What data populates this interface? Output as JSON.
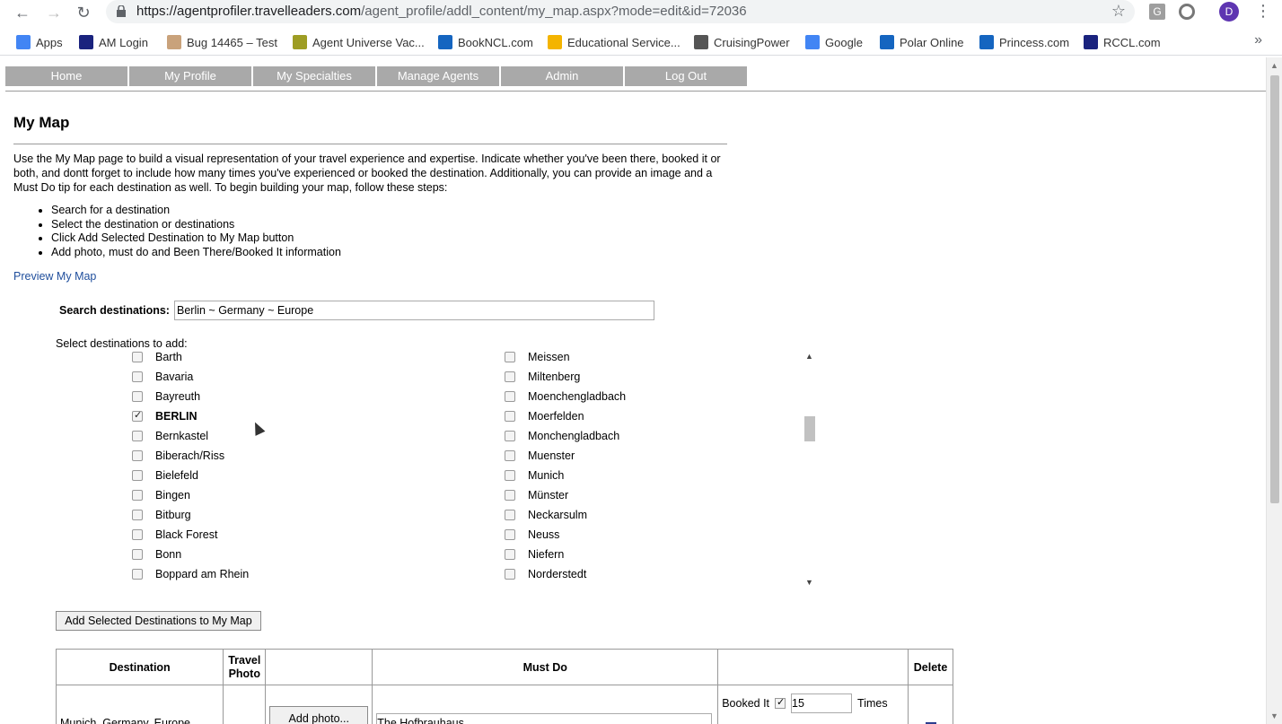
{
  "browser": {
    "url_domain": "https://agentprofiler.travelleaders.com",
    "url_path": "/agent_profile/addl_content/my_map.aspx?mode=edit&id=72036",
    "profile_initial": "D"
  },
  "bookmarks": [
    {
      "label": "Apps",
      "icon": "apps-grid-icon",
      "color": "#4285f4"
    },
    {
      "label": "AM Login",
      "icon": "am-login-icon",
      "color": "#1a237e"
    },
    {
      "label": "Bug 14465 – Test",
      "icon": "bug-icon",
      "color": "#c9a27b"
    },
    {
      "label": "Agent Universe Vac...",
      "icon": "agent-universe-icon",
      "color": "#9e9d24"
    },
    {
      "label": "BookNCL.com",
      "icon": "ncl-icon",
      "color": "#1565c0"
    },
    {
      "label": "Educational Service...",
      "icon": "drive-icon",
      "color": "#f4b400"
    },
    {
      "label": "CruisingPower",
      "icon": "cruisingpower-icon",
      "color": "#555555"
    },
    {
      "label": "Google",
      "icon": "google-icon",
      "color": "#4285f4"
    },
    {
      "label": "Polar Online",
      "icon": "polar-online-icon",
      "color": "#1565c0"
    },
    {
      "label": "Princess.com",
      "icon": "princess-icon",
      "color": "#1565c0"
    },
    {
      "label": "RCCL.com",
      "icon": "rccl-icon",
      "color": "#1a237e"
    }
  ],
  "menu": [
    "Home",
    "My Profile",
    "My Specialties",
    "Manage Agents",
    "Admin",
    "Log Out"
  ],
  "page": {
    "title": "My Map",
    "intro": "Use the My Map page to build a visual representation of your travel experience and expertise. Indicate whether you've been there, booked it or both, and dontt forget to include how many times you've experienced or booked the destination. Additionally, you can provide an image and a Must Do tip for each destination as well. To begin building your map, follow these steps:",
    "steps": [
      "Search for a destination",
      "Select the destination or destinations",
      "Click Add Selected Destination to My Map button",
      "Add photo, must do and Been There/Booked It information"
    ],
    "preview_link": "Preview My Map"
  },
  "search": {
    "label": "Search destinations:",
    "value": "Berlin ~ Germany ~ Europe"
  },
  "select_label": "Select destinations to add:",
  "destinations_left": [
    {
      "name": "Barth",
      "checked": false
    },
    {
      "name": "Bavaria",
      "checked": false
    },
    {
      "name": "Bayreuth",
      "checked": false
    },
    {
      "name": "BERLIN",
      "checked": true
    },
    {
      "name": "Bernkastel",
      "checked": false
    },
    {
      "name": "Biberach/Riss",
      "checked": false
    },
    {
      "name": "Bielefeld",
      "checked": false
    },
    {
      "name": "Bingen",
      "checked": false
    },
    {
      "name": "Bitburg",
      "checked": false
    },
    {
      "name": "Black Forest",
      "checked": false
    },
    {
      "name": "Bonn",
      "checked": false
    },
    {
      "name": "Boppard am Rhein",
      "checked": false
    }
  ],
  "destinations_right": [
    {
      "name": "Meissen",
      "checked": false
    },
    {
      "name": "Miltenberg",
      "checked": false
    },
    {
      "name": "Moenchengladbach",
      "checked": false
    },
    {
      "name": "Moerfelden",
      "checked": false
    },
    {
      "name": "Monchengladbach",
      "checked": false
    },
    {
      "name": "Muenster",
      "checked": false
    },
    {
      "name": "Munich",
      "checked": false
    },
    {
      "name": "Münster",
      "checked": false
    },
    {
      "name": "Neckarsulm",
      "checked": false
    },
    {
      "name": "Neuss",
      "checked": false
    },
    {
      "name": "Niefern",
      "checked": false
    },
    {
      "name": "Norderstedt",
      "checked": false
    }
  ],
  "add_button": "Add Selected Destinations to My Map",
  "table": {
    "headers": {
      "destination": "Destination",
      "travel_photo": "Travel Photo",
      "must_do": "Must Do",
      "delete": "Delete"
    },
    "rows": [
      {
        "destination": "Munich, Germany, Europe",
        "photo_button": "Add photo...",
        "must_do": "The Hofbrauhaus",
        "booked_label": "Booked It",
        "booked_checked": true,
        "times_value": "15",
        "times_label": "Times"
      }
    ]
  }
}
